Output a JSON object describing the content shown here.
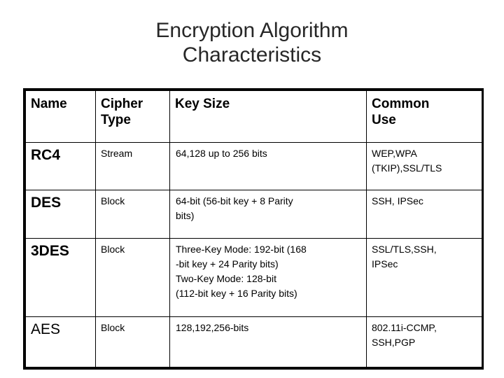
{
  "slide": {
    "title": "Encryption Algorithm\nCharacteristics"
  },
  "table": {
    "columns": [
      {
        "key": "name",
        "label": "Name"
      },
      {
        "key": "cipher_type",
        "label": "Cipher\nType"
      },
      {
        "key": "key_size",
        "label": "Key Size"
      },
      {
        "key": "common_use",
        "label": "Common\nUse"
      }
    ],
    "rows": [
      {
        "name": "RC4",
        "name_bold": true,
        "cipher_type": "Stream",
        "key_size": "64,128 up to 256 bits",
        "common_use": "WEP,WPA\n(TKIP),SSL/TLS"
      },
      {
        "name": "DES",
        "name_bold": true,
        "cipher_type": "Block",
        "key_size": "64-bit (56-bit key + 8 Parity\nbits)",
        "common_use": "SSH, IPSec"
      },
      {
        "name": "3DES",
        "name_bold": true,
        "cipher_type": "Block",
        "key_size": "Three-Key Mode: 192-bit (168\n-bit key + 24 Parity bits)\nTwo-Key Mode: 128-bit\n(112-bit key + 16 Parity bits)",
        "common_use": "SSL/TLS,SSH,\nIPSec"
      },
      {
        "name": "AES",
        "name_bold": false,
        "cipher_type": "Block",
        "key_size": "128,192,256-bits",
        "common_use": "802.11i-CCMP,\nSSH,PGP"
      }
    ]
  },
  "colors": {
    "page_background": "#ffffff",
    "title_text": "#272727",
    "table_border": "#000000",
    "body_text": "#000000"
  }
}
